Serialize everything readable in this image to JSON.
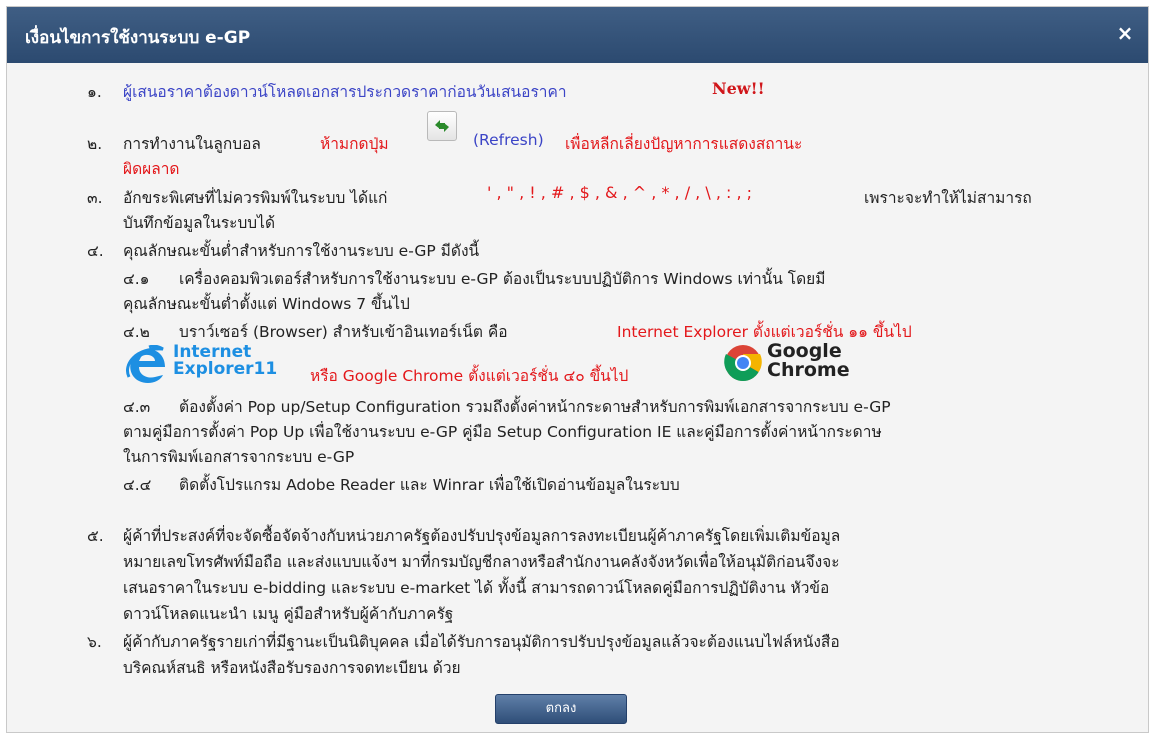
{
  "dialog": {
    "title": "เงื่อนไขการใช้งานระบบ e-GP",
    "close_symbol": "×",
    "ok_label": "ตกลง"
  },
  "items": {
    "i1": {
      "num": "๑.",
      "text": "ผู้เสนอราคาต้องดาวน์โหลดเอกสารประกวดราคาก่อนวันเสนอราคา",
      "badge": "New!!"
    },
    "i2": {
      "num": "๒.",
      "text_a": "การทำงานในลูกบอล",
      "text_b": "ห้ามกดปุ่ม",
      "text_c": "(Refresh)",
      "text_d": "เพื่อหลีกเลี่ยงปัญหาการแสดงสถานะ",
      "text_e": "ผิดผลาด",
      "refresh_icon": "refresh-icon"
    },
    "i3": {
      "num": "๓.",
      "text_a": "อักขระพิเศษที่ไม่ควรพิมพ์ในระบบ ได้แก่",
      "chars": "' , \" , ! , # , $ , & , ^ , * , / , \\ , : , ;",
      "text_b": "เพราะจะทำให้ไม่สามารถ",
      "text_c": "บันทึกข้อมูลในระบบได้"
    },
    "i4": {
      "num": "๔.",
      "text": "คุณลักษณะขั้นต่ำสำหรับการใช้งานระบบ e-GP มีดังนี้",
      "s1_num": "๔.๑",
      "s1_a": "เครื่องคอมพิวเตอร์สำหรับการใช้งานระบบ e-GP ต้องเป็นระบบปฏิบัติการ Windows เท่านั้น โดยมี",
      "s1_b": "คุณลักษณะขั้นต่ำตั้งแต่ Windows 7 ขึ้นไป",
      "s2_num": "๔.๒",
      "s2_a": "บราว์เซอร์ (Browser) สำหรับเข้าอินเทอร์เน็ต คือ",
      "s2_b": "Internet Explorer ตั้งแต่เวอร์ชั่น ๑๑ ขึ้นไป",
      "ie_logo_line1": "Internet",
      "ie_logo_line2": "Explorer11",
      "s2_c": "หรือ Google Chrome ตั้งแต่เวอร์ชั่น ๔๐ ขึ้นไป",
      "chrome_logo_line1": "Google",
      "chrome_logo_line2": "Chrome",
      "s3_num": "๔.๓",
      "s3_a": "ต้องตั้งค่า Pop up/Setup Configuration รวมถึงตั้งค่าหน้ากระดาษสำหรับการพิมพ์เอกสารจากระบบ e-GP",
      "s3_b": "ตามคู่มือการตั้งค่า Pop Up เพื่อใช้งานระบบ e-GP คู่มือ Setup Configuration IE และคู่มือการตั้งค่าหน้ากระดาษ",
      "s3_c": "ในการพิมพ์เอกสารจากระบบ e-GP",
      "s4_num": "๔.๔",
      "s4_a": "ติดตั้งโปรแกรม Adobe Reader และ Winrar เพื่อใช้เปิดอ่านข้อมูลในระบบ"
    },
    "i5": {
      "num": "๕.",
      "a": "ผู้ค้าที่ประสงค์ที่จะจัดซื้อจัดจ้างกับหน่วยภาครัฐต้องปรับปรุงข้อมูลการลงทะเบียนผู้ค้าภาครัฐโดยเพิ่มเติมข้อมูล",
      "b": "หมายเลขโทรศัพท์มือถือ และส่งแบบแจ้งฯ มาที่กรมบัญชีกลางหรือสำนักงานคลังจังหวัดเพื่อให้อนุมัติก่อนจึงจะ",
      "c": "เสนอราคาในระบบ e-bidding และระบบ e-market ได้ ทั้งนี้ สามารถดาวน์โหลดคู่มือการปฏิบัติงาน หัวข้อ",
      "d": "ดาวน์โหลดแนะนำ เมนู คู่มือสำหรับผู้ค้ากับภาครัฐ"
    },
    "i6": {
      "num": "๖.",
      "a": "ผู้ค้ากับภาครัฐรายเก่าที่มีฐานะเป็นนิติบุคคล เมื่อได้รับการอนุมัติการปรับปรุงข้อมูลแล้วจะต้องแนบไฟล์หนังสือ",
      "b": "บริคณห์สนธิ หรือหนังสือรับรองการจดทะเบียน ด้วย"
    }
  },
  "colors": {
    "titlebar": "#34537b",
    "accent_red": "#e3181b",
    "link_blue": "#3b44c6",
    "new_red": "#d0161a"
  }
}
